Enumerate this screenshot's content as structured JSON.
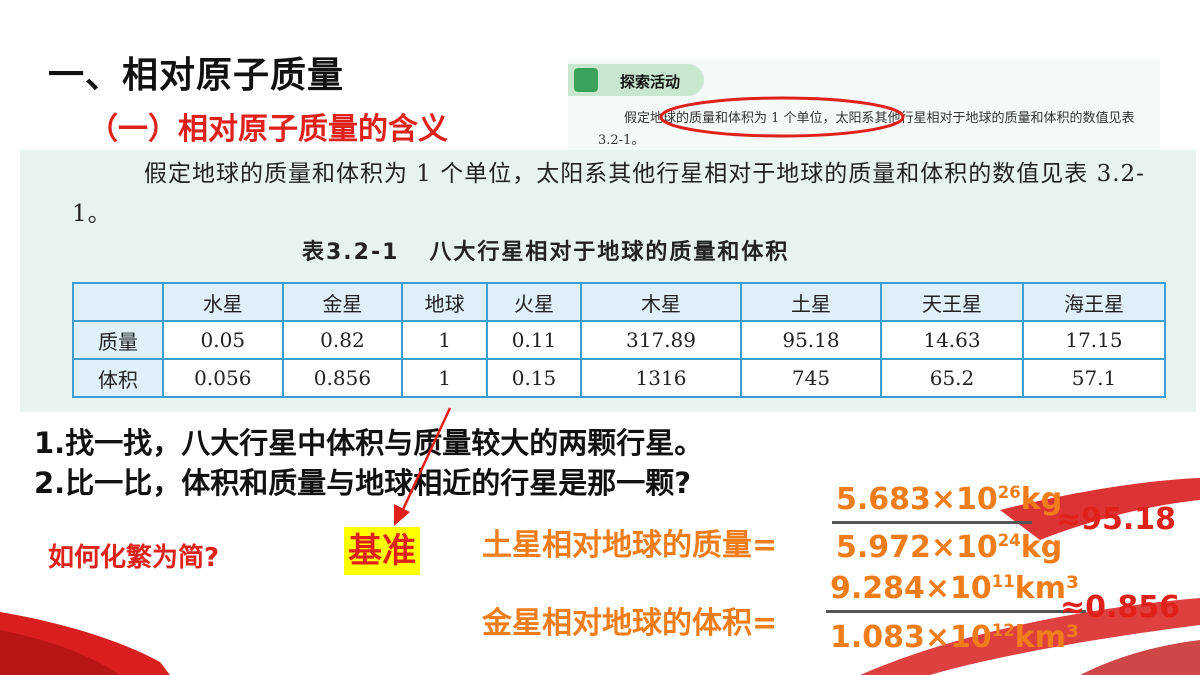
{
  "title": "一、相对原子质量",
  "subtitle": "（一）相对原子质量的含义",
  "snippet": {
    "tag": "探索活动",
    "text": "假定地球的质量和体积为 1 个单位，太阳系其他行星相对于地球的质量和体积的数值见表 3.2-1。"
  },
  "panel": {
    "paragraph": "假定地球的质量和体积为 1 个单位，太阳系其他行星相对于地球的质量和体积的数值见表 3.2-1。",
    "caption_no": "表3.2-1",
    "caption_title": "八大行星相对于地球的质量和体积"
  },
  "table": {
    "headers": [
      "",
      "水星",
      "金星",
      "地球",
      "火星",
      "木星",
      "土星",
      "天王星",
      "海王星"
    ],
    "rows": [
      [
        "质量",
        "0.05",
        "0.82",
        "1",
        "0.11",
        "317.89",
        "95.18",
        "14.63",
        "17.15"
      ],
      [
        "体积",
        "0.056",
        "0.856",
        "1",
        "0.15",
        "1316",
        "745",
        "65.2",
        "57.1"
      ]
    ]
  },
  "questions": {
    "q1": "1.找一找，八大行星中体积与质量较大的两颗行星。",
    "q2": "2.比一比，体积和质量与地球相近的行星是那一颗?"
  },
  "how": "如何化繁为简?",
  "base": "基准",
  "eq1": {
    "label": "土星相对地球的质量=",
    "num_mantissa": "5.683×10",
    "num_exp": "26",
    "num_unit": "kg",
    "den_mantissa": "5.972×10",
    "den_exp": "24",
    "den_unit": "kg",
    "result": "≈95.18"
  },
  "eq2": {
    "label": "金星相对地球的体积=",
    "num_mantissa": "9.284×10",
    "num_exp": "11",
    "num_unit": "km³",
    "den_mantissa": "1.083×10",
    "den_exp": "12",
    "den_unit": "km³",
    "result": "≈0.856"
  },
  "colors": {
    "accent_red": "#e0201b",
    "orange": "#f07d1a",
    "panel_bg": "#e8f3ef",
    "table_border": "#3d9fcf"
  }
}
